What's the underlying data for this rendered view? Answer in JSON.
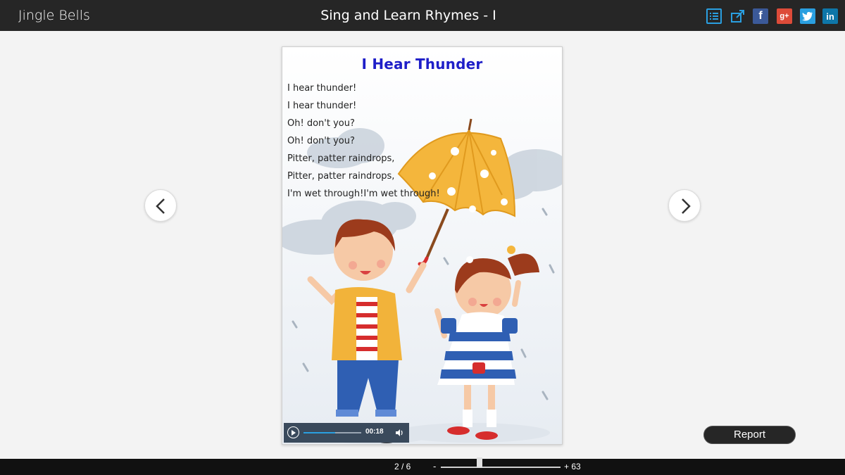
{
  "header": {
    "app_title": "Jingle Bells",
    "book_title": "Sing and Learn Rhymes - I",
    "icons": [
      "list-icon",
      "external-link-icon",
      "facebook-icon",
      "google-plus-icon",
      "twitter-icon",
      "linkedin-icon"
    ],
    "facebook_glyph": "f",
    "google_glyph": "g+",
    "linkedin_glyph": "in"
  },
  "page": {
    "title": "I Hear Thunder",
    "lines": [
      "I hear thunder!",
      "I hear thunder!",
      "Oh! don't you?",
      "Oh! don't you?",
      "Pitter, patter raindrops,",
      "Pitter, patter raindrops,",
      "I'm wet through!I'm wet through!"
    ],
    "title_color": "#1e1ec8"
  },
  "player": {
    "time": "00:18",
    "progress": 0.55
  },
  "actions": {
    "report_label": "Report"
  },
  "footer": {
    "page_counter": "2 / 6",
    "zoom_minus": "-",
    "zoom_plus": "+ 63"
  },
  "colors": {
    "topbar": "#262626",
    "accent": "#2a9fe0"
  }
}
